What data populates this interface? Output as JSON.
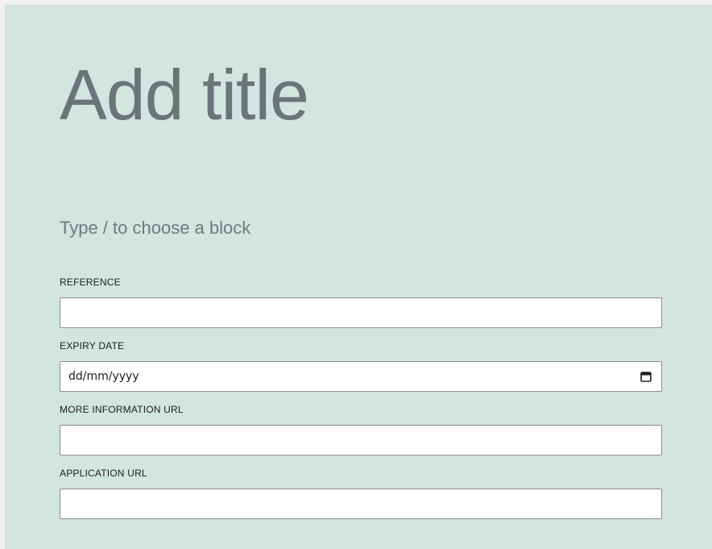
{
  "editor": {
    "title_placeholder": "Add title",
    "block_hint": "Type / to choose a block"
  },
  "fields": {
    "reference": {
      "label": "REFERENCE",
      "value": ""
    },
    "expiry_date": {
      "label": "EXPIRY DATE",
      "placeholder": "dd/mm/yyyy",
      "icon": "calendar-icon"
    },
    "more_info_url": {
      "label": "MORE INFORMATION URL",
      "value": ""
    },
    "application_url": {
      "label": "APPLICATION URL",
      "value": ""
    }
  },
  "colors": {
    "canvas_background": "#d2e5df",
    "title_color": "#6b7478",
    "input_border": "#8c8f94"
  }
}
